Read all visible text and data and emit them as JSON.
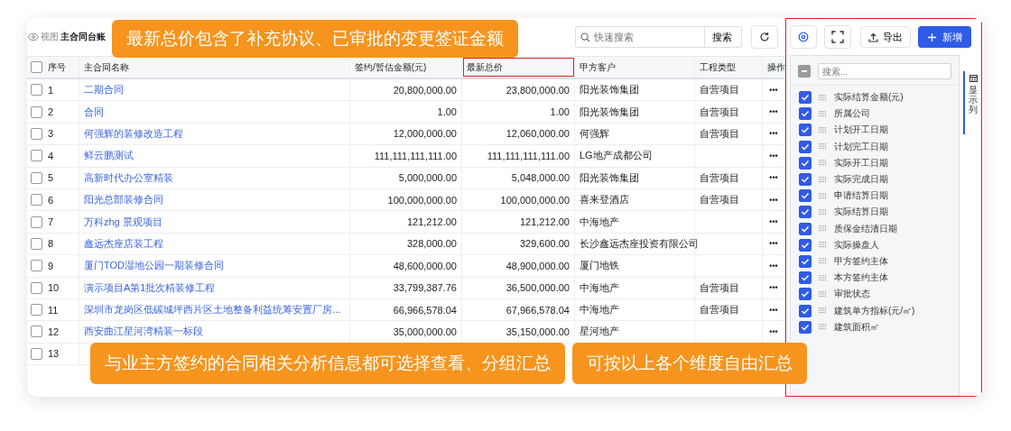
{
  "toolbar": {
    "view_label": "视图",
    "view_name": "主合同台账",
    "search": {
      "placeholder": "快速搜索"
    },
    "search_button": "搜索",
    "export_button": "导出",
    "add_button": "新增"
  },
  "table": {
    "all_checked": false,
    "columns": [
      {
        "label": "序号",
        "highlighted": false
      },
      {
        "label": "主合同名称",
        "highlighted": false
      },
      {
        "label": "签约/暂估金额(元)",
        "highlighted": false
      },
      {
        "label": "最新总价",
        "highlighted": true
      },
      {
        "label": "甲方客户",
        "highlighted": false
      },
      {
        "label": "工程类型",
        "highlighted": false
      },
      {
        "label": "操作",
        "highlighted": false
      }
    ],
    "rows": [
      {
        "checked": false,
        "seq": "1",
        "name": "二期合同",
        "signed_amount": "20,800,000.00",
        "latest_total": "23,800,000.00",
        "client": "阳光装饰集团",
        "project_type": "自营项目",
        "action": "•••"
      },
      {
        "checked": false,
        "seq": "2",
        "name": "合同",
        "signed_amount": "1.00",
        "latest_total": "1.00",
        "client": "阳光装饰集团",
        "project_type": "自营项目",
        "action": "•••"
      },
      {
        "checked": false,
        "seq": "3",
        "name": "何强辉的装修改造工程",
        "signed_amount": "12,000,000.00",
        "latest_total": "12,060,000.00",
        "client": "何强辉",
        "project_type": "自营项目",
        "action": "•••"
      },
      {
        "checked": false,
        "seq": "4",
        "name": "鲜云鹏测试",
        "signed_amount": "111,111,111,111.00",
        "latest_total": "111,111,111,111.00",
        "client": "LG地产成都公司",
        "action": "•••"
      },
      {
        "checked": false,
        "seq": "5",
        "name": "高新时代办公室精装",
        "signed_amount": "5,000,000.00",
        "latest_total": "5,048,000.00",
        "client": "阳光装饰集团",
        "project_type": "自营项目",
        "action": "•••"
      },
      {
        "checked": false,
        "seq": "6",
        "name": "阳光总部装修合同",
        "signed_amount": "100,000,000.00",
        "latest_total": "100,000,000.00",
        "client": "喜来登酒店",
        "project_type": "自营项目",
        "action": "•••"
      },
      {
        "checked": false,
        "seq": "7",
        "name": "万科zhg 景观项目",
        "signed_amount": "121,212.00",
        "latest_total": "121,212.00",
        "client": "中海地产",
        "action": "•••"
      },
      {
        "checked": false,
        "seq": "8",
        "name": "鑫远杰座店装工程",
        "signed_amount": "328,000.00",
        "latest_total": "329,600.00",
        "client": "长沙鑫远杰座投资有限公司",
        "action": "•••"
      },
      {
        "checked": false,
        "seq": "9",
        "name": "厦门TOD湿地公园一期装修合同",
        "signed_amount": "48,600,000.00",
        "latest_total": "48,900,000.00",
        "client": "厦门地铁",
        "action": "•••"
      },
      {
        "checked": false,
        "seq": "10",
        "name": "演示项目A第1批次精装修工程",
        "signed_amount": "33,799,387.76",
        "latest_total": "36,500,000.00",
        "client": "中海地产",
        "project_type": "自营项目",
        "action": "•••"
      },
      {
        "checked": false,
        "seq": "11",
        "name": "深圳市龙岗区低碳城坪西片区土地整备利益统筹安置厂房...",
        "signed_amount": "66,966,578.04",
        "latest_total": "67,966,578.04",
        "client": "中海地产",
        "project_type": "自营项目",
        "action": "•••"
      },
      {
        "checked": false,
        "seq": "12",
        "name": "西安曲江星河湾精装一标段",
        "signed_amount": "35,000,000.00",
        "latest_total": "35,150,000.00",
        "client": "星河地产",
        "action": "•••"
      },
      {
        "checked": false,
        "seq": "13"
      }
    ]
  },
  "column_panel": {
    "highlighted": true,
    "indeterminate": true,
    "search": {
      "placeholder": "搜索..."
    },
    "tab_label": "显示列",
    "items": [
      {
        "label": "实际结算金额(元)",
        "checked": true
      },
      {
        "label": "所属公司",
        "checked": true
      },
      {
        "label": "计划开工日期",
        "checked": true
      },
      {
        "label": "计划完工日期",
        "checked": true
      },
      {
        "label": "实际开工日期",
        "checked": true
      },
      {
        "label": "实际完成日期",
        "checked": true
      },
      {
        "label": "申请结算日期",
        "checked": true
      },
      {
        "label": "实际结算日期",
        "checked": true
      },
      {
        "label": "质保金结清日期",
        "checked": true
      },
      {
        "label": "实际操盘人",
        "checked": true
      },
      {
        "label": "甲方签约主体",
        "checked": true
      },
      {
        "label": "本方签约主体",
        "checked": true
      },
      {
        "label": "审批状态",
        "checked": true
      },
      {
        "label": "建筑单方指标(元/㎡)",
        "checked": true
      },
      {
        "label": "建筑面积㎡",
        "checked": true
      }
    ]
  },
  "callouts": {
    "top": "最新总价包含了补充协议、已审批的变更签证金额",
    "bottom": [
      "与业主方签约的合同相关分析信息都可选择查看、分组汇总",
      "可按以上各个维度自由汇总"
    ]
  }
}
